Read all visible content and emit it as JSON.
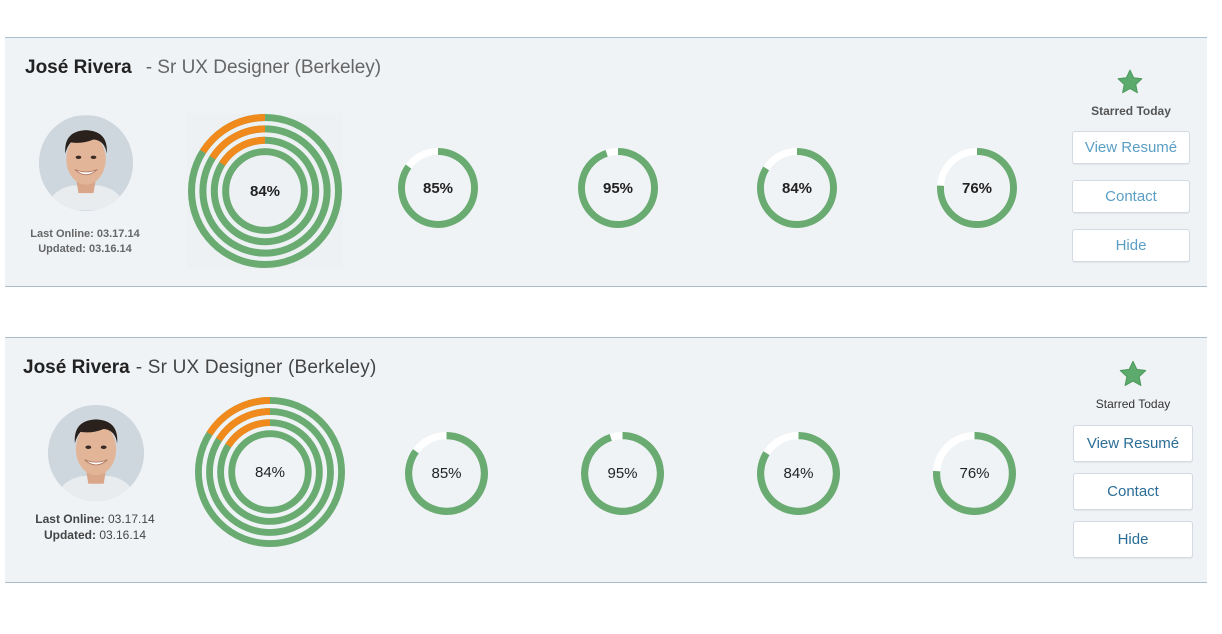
{
  "cards": [
    {
      "name": "José Rivera",
      "role": "- Sr UX Designer (Berkeley)",
      "last_online_label": "Last Online:",
      "last_online_value": "03.17.14",
      "updated_label": "Updated:",
      "updated_value": "03.16.14",
      "overall_score": "84%",
      "scores": [
        "85%",
        "95%",
        "84%",
        "76%"
      ],
      "starred_label": "Starred Today",
      "buttons": {
        "resume": "View Resumé",
        "contact": "Contact",
        "hide": "Hide"
      }
    },
    {
      "name": "José Rivera",
      "role": "- Sr UX Designer (Berkeley)",
      "last_online_label": "Last Online:",
      "last_online_value": "03.17.14",
      "updated_label": "Updated:",
      "updated_value": "03.16.14",
      "overall_score": "84%",
      "scores": [
        "85%",
        "95%",
        "84%",
        "76%"
      ],
      "starred_label": "Starred Today",
      "buttons": {
        "resume": "View Resumé",
        "contact": "Contact",
        "hide": "Hide"
      }
    }
  ],
  "progress": {
    "overall_fraction": 0.84,
    "score_fractions": [
      0.85,
      0.95,
      0.84,
      0.76
    ]
  },
  "colors": {
    "progress_green": "#6aab72",
    "highlight_orange": "#f08a1c",
    "track_white": "#ffffff",
    "star_green": "#5cab6c"
  },
  "icons": {
    "star": "star-icon",
    "avatar": "avatar-photo"
  }
}
